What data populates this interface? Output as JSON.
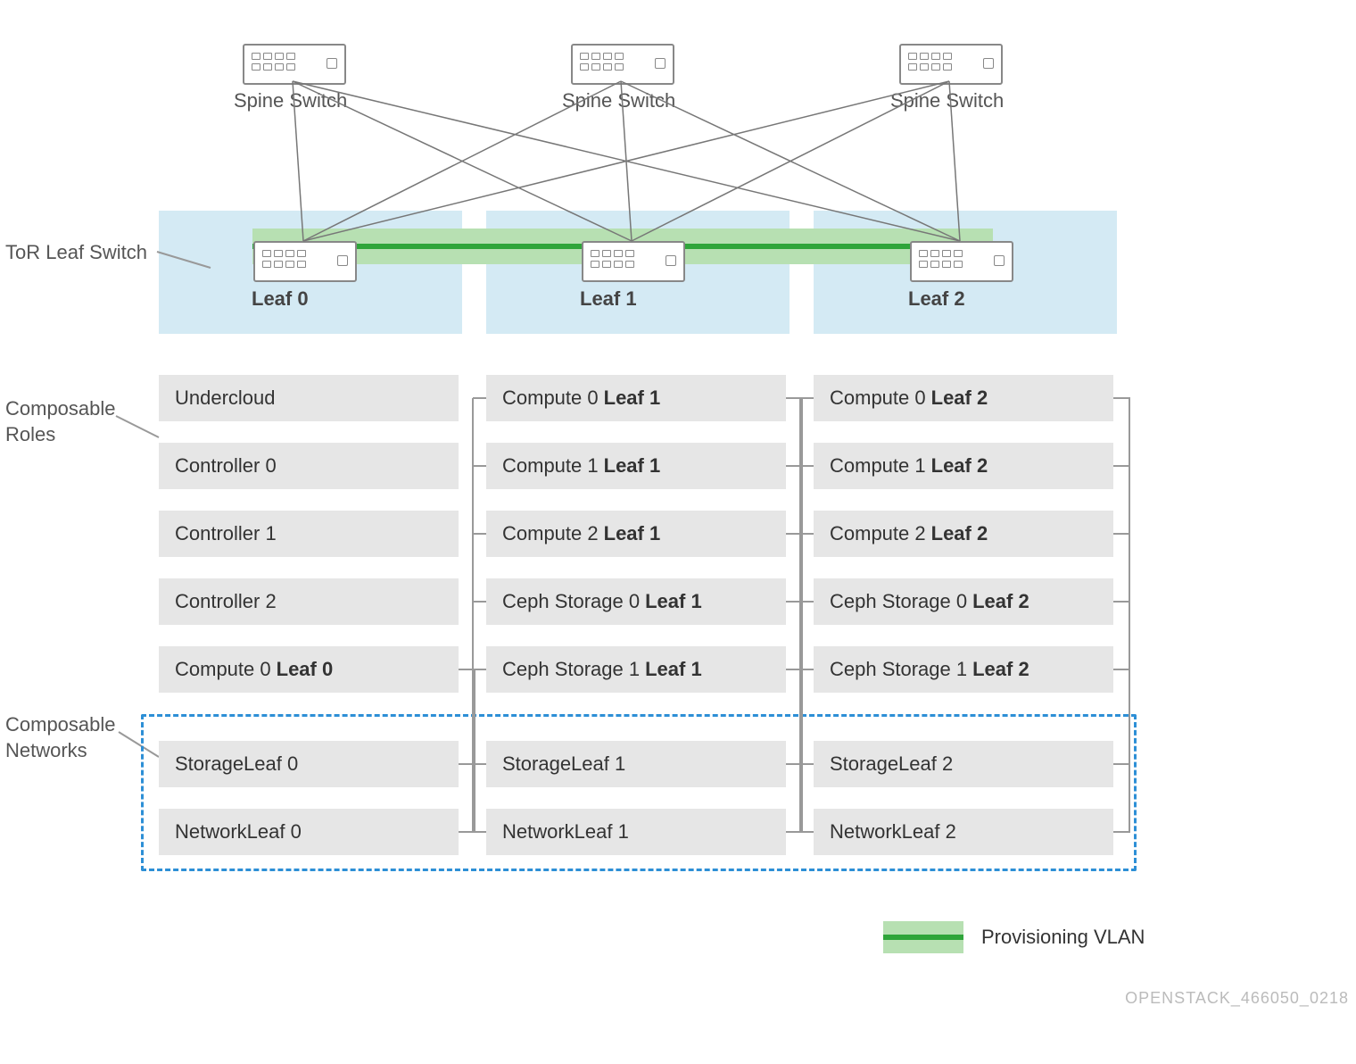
{
  "spines": [
    {
      "label": "Spine Switch"
    },
    {
      "label": "Spine Switch"
    },
    {
      "label": "Spine Switch"
    }
  ],
  "side_labels": {
    "tor": "ToR Leaf Switch",
    "roles": "Composable\nRoles",
    "networks": "Composable\nNetworks"
  },
  "leaves": [
    {
      "label": "Leaf 0"
    },
    {
      "label": "Leaf 1"
    },
    {
      "label": "Leaf 2"
    }
  ],
  "col0_roles": [
    {
      "text": "Undercloud",
      "bold": ""
    },
    {
      "text": "Controller 0",
      "bold": ""
    },
    {
      "text": "Controller 1",
      "bold": ""
    },
    {
      "text": "Controller 2",
      "bold": ""
    },
    {
      "text": "Compute 0",
      "bold": "Leaf 0"
    }
  ],
  "col1_roles": [
    {
      "text": "Compute 0",
      "bold": "Leaf 1"
    },
    {
      "text": "Compute 1",
      "bold": "Leaf 1"
    },
    {
      "text": "Compute 2",
      "bold": "Leaf 1"
    },
    {
      "text": "Ceph Storage 0",
      "bold": "Leaf 1"
    },
    {
      "text": "Ceph Storage 1",
      "bold": "Leaf 1"
    }
  ],
  "col2_roles": [
    {
      "text": "Compute 0",
      "bold": "Leaf 2"
    },
    {
      "text": "Compute 1",
      "bold": "Leaf 2"
    },
    {
      "text": "Compute 2",
      "bold": "Leaf 2"
    },
    {
      "text": "Ceph Storage 0",
      "bold": "Leaf 2"
    },
    {
      "text": "Ceph Storage 1",
      "bold": "Leaf 2"
    }
  ],
  "col0_nets": [
    {
      "text": "StorageLeaf 0"
    },
    {
      "text": "NetworkLeaf 0"
    }
  ],
  "col1_nets": [
    {
      "text": "StorageLeaf 1"
    },
    {
      "text": "NetworkLeaf 1"
    }
  ],
  "col2_nets": [
    {
      "text": "StorageLeaf 2"
    },
    {
      "text": "NetworkLeaf 2"
    }
  ],
  "legend": {
    "label": "Provisioning VLAN"
  },
  "footer": "OPENSTACK_466050_0218",
  "chart_data": {
    "type": "diagram",
    "title": "Spine-Leaf network topology with composable roles and networks",
    "spine_switches": [
      "Spine Switch",
      "Spine Switch",
      "Spine Switch"
    ],
    "leaf_switches": [
      "Leaf 0",
      "Leaf 1",
      "Leaf 2"
    ],
    "connections": "full mesh between all spine switches and all leaf switches",
    "provisioning_vlan": "spans Leaf 0, Leaf 1, Leaf 2",
    "columns": [
      {
        "leaf": "Leaf 0",
        "composable_roles": [
          "Undercloud",
          "Controller 0",
          "Controller 1",
          "Controller 2",
          "Compute 0 Leaf 0"
        ],
        "composable_networks": [
          "StorageLeaf 0",
          "NetworkLeaf 0"
        ]
      },
      {
        "leaf": "Leaf 1",
        "composable_roles": [
          "Compute 0 Leaf 1",
          "Compute 1 Leaf 1",
          "Compute 2 Leaf 1",
          "Ceph Storage 0 Leaf 1",
          "Ceph Storage 1 Leaf 1"
        ],
        "composable_networks": [
          "StorageLeaf 1",
          "NetworkLeaf 1"
        ]
      },
      {
        "leaf": "Leaf 2",
        "composable_roles": [
          "Compute 0 Leaf 2",
          "Compute 1 Leaf 2",
          "Compute 2 Leaf 2",
          "Ceph Storage 0 Leaf 2",
          "Ceph Storage 1 Leaf 2"
        ],
        "composable_networks": [
          "StorageLeaf 2",
          "NetworkLeaf 2"
        ]
      }
    ],
    "legend": {
      "Provisioning VLAN": "green band with dark green line"
    },
    "footer_id": "OPENSTACK_466050_0218"
  }
}
